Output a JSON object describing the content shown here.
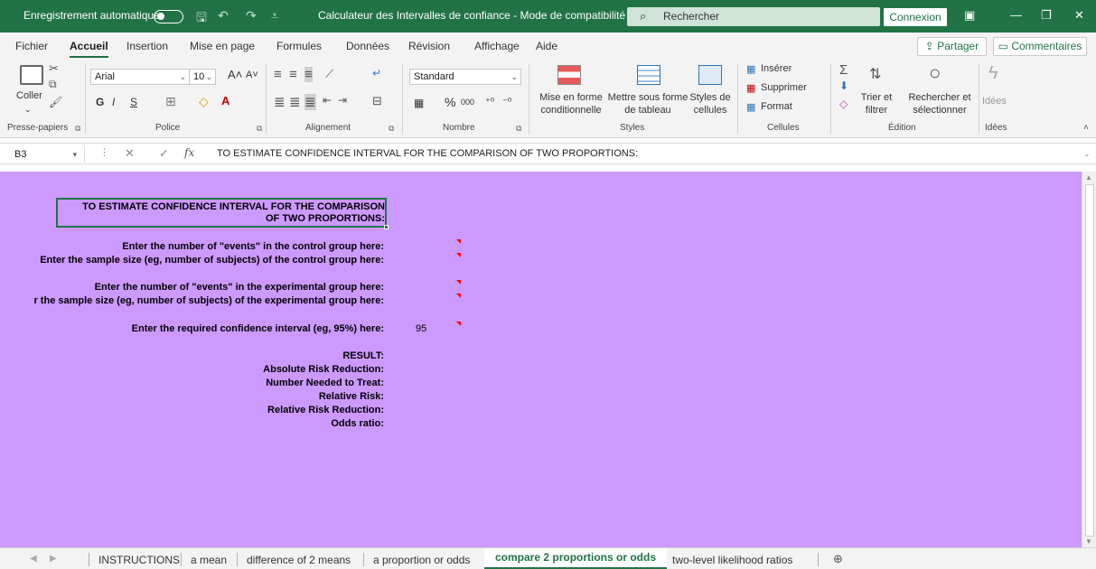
{
  "titlebar": {
    "autosave_label": "Enregistrement automatique",
    "title": "Calculateur des Intervalles de confiance  -  Mode de compatibilité",
    "title_caret": "⌄",
    "search_label": "Rechercher",
    "login_label": "Connexion"
  },
  "ribbon_tabs": [
    "Fichier",
    "Accueil",
    "Insertion",
    "Mise en page",
    "Formules",
    "Données",
    "Révision",
    "Affichage",
    "Aide"
  ],
  "share_label": "Partager",
  "comments_label": "Commentaires",
  "ribbon": {
    "clipboard": {
      "paste_label": "Coller",
      "group_label": "Presse-papiers"
    },
    "font": {
      "family": "Arial",
      "size": "10",
      "bold": "G",
      "italic": "I",
      "underline": "S",
      "group_label": "Police"
    },
    "alignment": {
      "group_label": "Alignement"
    },
    "number": {
      "format": "Standard",
      "percent": "%",
      "thousands": "000",
      "group_label": "Nombre"
    },
    "styles": {
      "conditional_line1": "Mise en forme",
      "conditional_line2": "conditionnelle",
      "table_line1": "Mettre sous forme",
      "table_line2": "de tableau",
      "cell_styles_line1": "Styles de",
      "cell_styles_line2": "cellules",
      "group_label": "Styles"
    },
    "cells": {
      "insert": "Insérer",
      "delete": "Supprimer",
      "format": "Format",
      "group_label": "Cellules"
    },
    "editing": {
      "sort_line1": "Trier et",
      "sort_line2": "filtrer",
      "find_line1": "Rechercher et",
      "find_line2": "sélectionner",
      "group_label": "Édition"
    },
    "ideas": {
      "label": "Idées",
      "group_label": "Idées"
    }
  },
  "formula_bar": {
    "name_box": "B3",
    "fx": "fx",
    "content": "TO ESTIMATE CONFIDENCE INTERVAL FOR THE COMPARISON OF TWO PROPORTIONS:"
  },
  "sheet": {
    "header_line1": "TO ESTIMATE CONFIDENCE INTERVAL FOR THE COMPARISON",
    "header_line2": "OF TWO PROPORTIONS:",
    "control_events": "Enter the number of \"events\" in the control group here:",
    "control_size": "Enter the sample size (eg, number of subjects) of the control group here:",
    "exp_events": "Enter the number of \"events\" in the experimental group here:",
    "exp_size": "r the sample size (eg, number of subjects) of the experimental group here:",
    "ci_label": "Enter the required confidence interval (eg, 95%) here:",
    "ci_value": "95",
    "result": "RESULT:",
    "arr": "Absolute Risk Reduction:",
    "nnt": "Number Needed to Treat:",
    "rr": "Relative Risk:",
    "rrr": "Relative Risk Reduction:",
    "or": "Odds ratio:"
  },
  "sheet_tabs": [
    "INSTRUCTIONS",
    "a mean",
    "difference of 2 means",
    "a proportion or odds",
    "compare 2 proportions or odds",
    "two-level likelihood ratios"
  ],
  "active_sheet_tab": "compare 2 proportions or odds",
  "colors": {
    "accent": "#217346",
    "sheet_bg": "#cc99ff",
    "comment_marker": "#ff0000"
  }
}
